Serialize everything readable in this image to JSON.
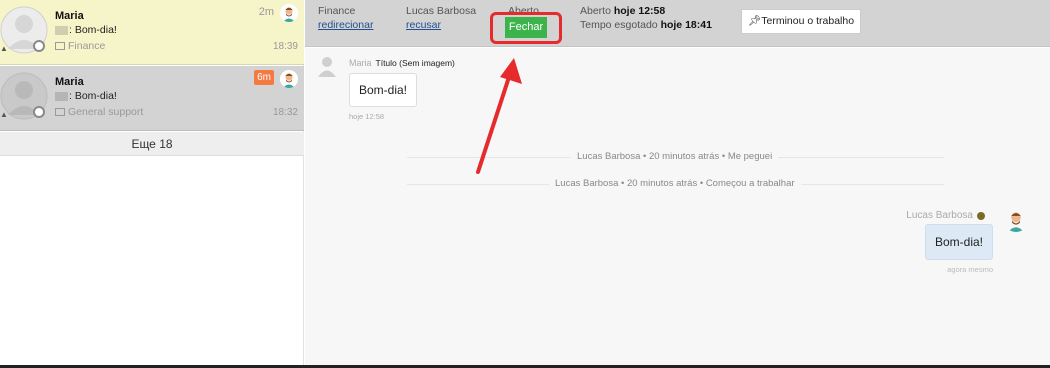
{
  "sidebar": {
    "conversations": [
      {
        "name": "Maria",
        "message": ": Bom-dia!",
        "department": "Finance",
        "wait": "2m",
        "time": "18:39",
        "wait_highlight": false
      },
      {
        "name": "Maria",
        "message": ": Bom-dia!",
        "department": "General support",
        "wait": "6m",
        "time": "18:32",
        "wait_highlight": true
      }
    ],
    "more_label": "Еще 18"
  },
  "header": {
    "department_label": "Finance",
    "redirect_link": "redirecionar",
    "agent_label": "Lucas Barbosa",
    "refuse_link": "recusar",
    "status_label": "Aberto",
    "close_button": "Fechar",
    "opened_prefix": "Aberto ",
    "opened_value": "hoje 12:58",
    "timeout_prefix": "Tempo esgotado ",
    "timeout_value": "hoje 18:41",
    "done_button": "Terminou o trabalho"
  },
  "chat": {
    "incoming": {
      "author": "Maria",
      "title": "Título (Sem imagem)",
      "text": "Bom-dia!",
      "time": "hoje 12:58"
    },
    "system_messages": [
      "Lucas Barbosa • 20 minutos atrás • Me peguei",
      "Lucas Barbosa • 20 minutos atrás • Começou a trabalhar"
    ],
    "outgoing": {
      "author": "Lucas Barbosa",
      "text": "Bom-dia!",
      "time": "agora mesmo"
    }
  },
  "colors": {
    "active_conversation_bg": "#f6f4c9",
    "header_bg": "#d3d3d3",
    "close_button": "#3cb44b",
    "annotation_red": "#e52b2b",
    "wait_badge": "#f47a42",
    "outgoing_bubble": "#dde9f4"
  },
  "icons": [
    "user-avatar-icon",
    "pin-icon",
    "mail-icon",
    "agent-avatar-icon",
    "person-icon",
    "arrow-annotation"
  ]
}
